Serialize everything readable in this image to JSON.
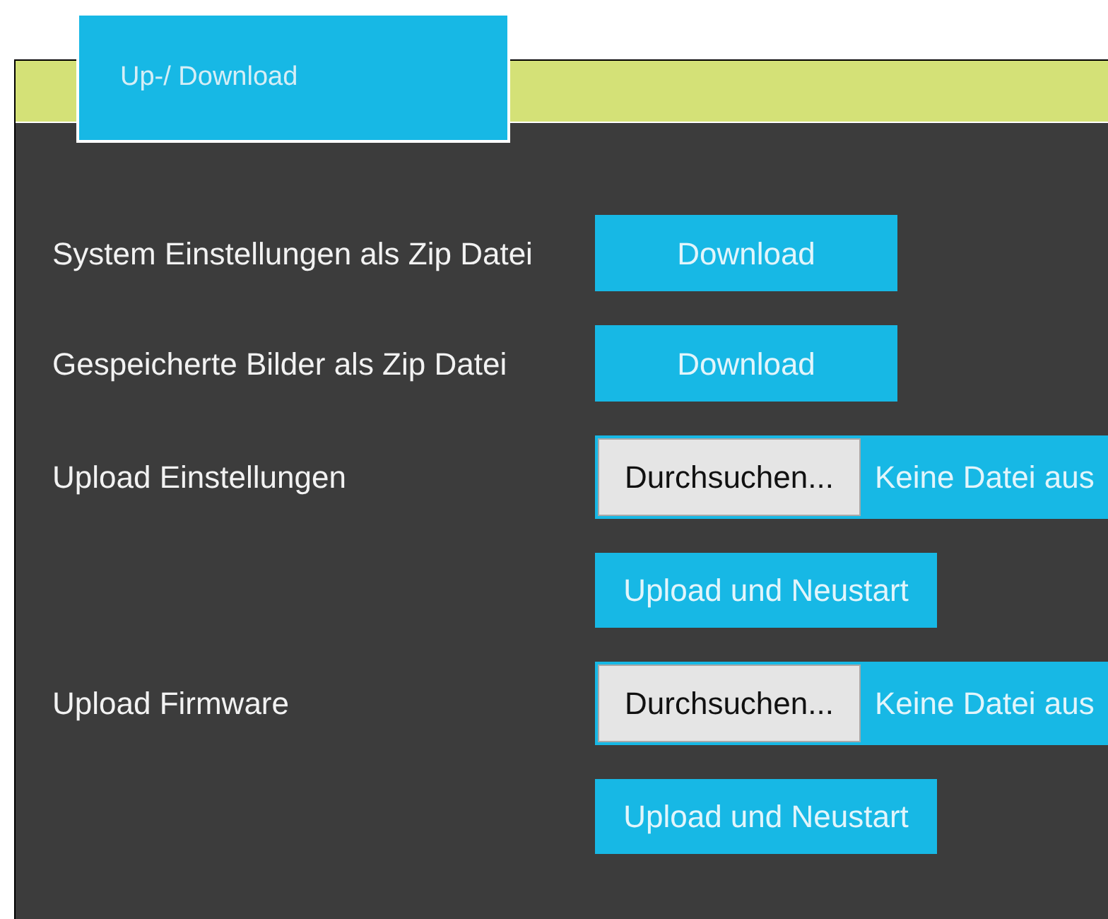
{
  "tab": {
    "label": "Up-/ Download",
    "selected": true
  },
  "rows": [
    {
      "kind": "download",
      "label": "System Einstellungen als Zip Datei",
      "button": "Download"
    },
    {
      "kind": "download",
      "label": "Gespeicherte Bilder als Zip Datei",
      "button": "Download"
    },
    {
      "kind": "upload",
      "label": "Upload Einstellungen",
      "browse_button": "Durchsuchen...",
      "file_status": "Keine Datei aus",
      "button": "Upload und Neustart"
    },
    {
      "kind": "upload",
      "label": "Upload Firmware",
      "browse_button": "Durchsuchen...",
      "file_status": "Keine Datei aus",
      "button": "Upload und Neustart"
    }
  ]
}
